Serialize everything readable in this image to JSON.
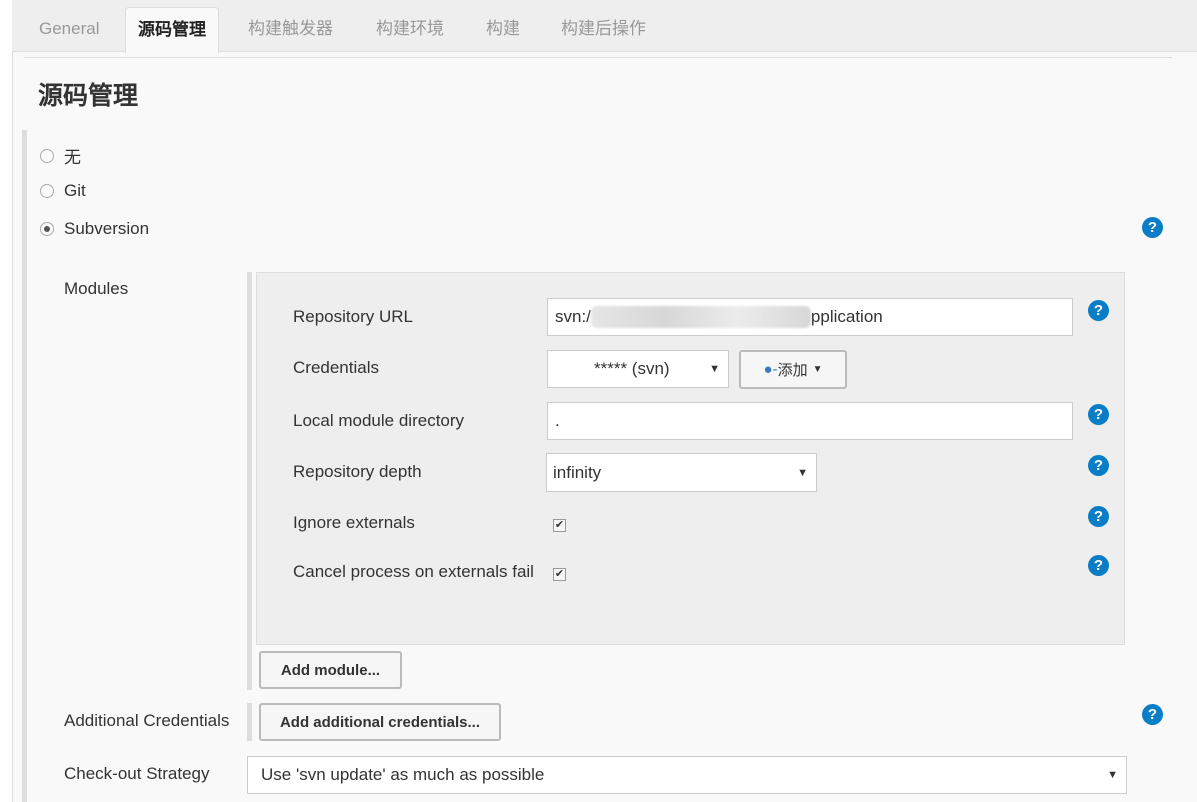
{
  "tabs": [
    {
      "label": "General"
    },
    {
      "label": "源码管理"
    },
    {
      "label": "构建触发器"
    },
    {
      "label": "构建环境"
    },
    {
      "label": "构建"
    },
    {
      "label": "构建后操作"
    }
  ],
  "section_title": "源码管理",
  "scm_options": [
    {
      "label": "无",
      "selected": false
    },
    {
      "label": "Git",
      "selected": false
    },
    {
      "label": "Subversion",
      "selected": true
    }
  ],
  "modules": {
    "label": "Modules",
    "repository_url": {
      "label": "Repository URL",
      "value_prefix": "svn:/",
      "value_suffix": "pplication"
    },
    "credentials": {
      "label": "Credentials",
      "value": "***** (svn)",
      "add_label": "添加"
    },
    "local_module_directory": {
      "label": "Local module directory",
      "value": "."
    },
    "repository_depth": {
      "label": "Repository depth",
      "value": "infinity"
    },
    "ignore_externals": {
      "label": "Ignore externals",
      "checked": true
    },
    "cancel_on_externals_fail": {
      "label": "Cancel process on externals fail",
      "checked": true
    },
    "add_module_label": "Add module..."
  },
  "additional_credentials": {
    "label": "Additional Credentials",
    "button": "Add additional credentials..."
  },
  "checkout_strategy": {
    "label": "Check-out Strategy",
    "value": "Use 'svn update' as much as possible"
  },
  "help_glyph": "?",
  "check_glyph": "✔",
  "colors": {
    "help": "#0a7dc7"
  }
}
